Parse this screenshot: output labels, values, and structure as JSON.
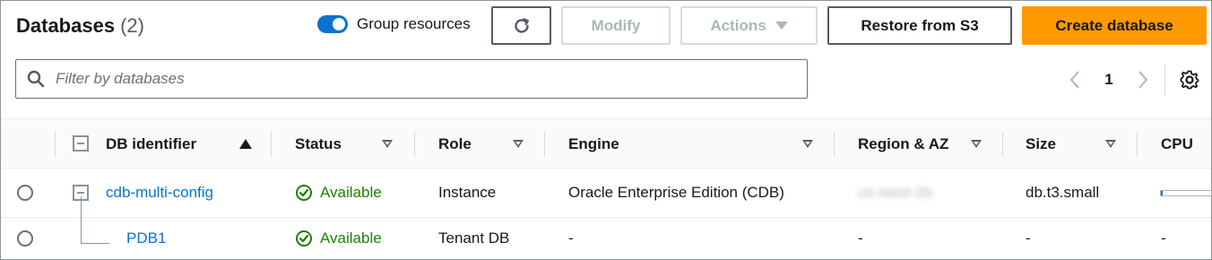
{
  "header": {
    "title": "Databases",
    "count": "(2)"
  },
  "group_resources": {
    "label": "Group resources",
    "enabled": true
  },
  "toolbar": {
    "refresh_icon": "refresh-icon",
    "modify_label": "Modify",
    "actions_label": "Actions",
    "restore_label": "Restore from S3",
    "create_label": "Create database"
  },
  "search": {
    "placeholder": "Filter by databases",
    "value": ""
  },
  "pagination": {
    "current_page": "1"
  },
  "table": {
    "columns": [
      {
        "label": "DB identifier",
        "sort": "ascending"
      },
      {
        "label": "Status",
        "sort": "none"
      },
      {
        "label": "Role",
        "sort": "none"
      },
      {
        "label": "Engine",
        "sort": "none"
      },
      {
        "label": "Region & AZ",
        "sort": "none"
      },
      {
        "label": "Size",
        "sort": "none"
      },
      {
        "label": "CPU",
        "sort": "none"
      }
    ],
    "rows": [
      {
        "identifier": "cdb-multi-config",
        "status": "Available",
        "role": "Instance",
        "engine": "Oracle Enterprise Edition (CDB)",
        "region": "us-west-2b",
        "size": "db.t3.small",
        "cpu_fraction": 0.03
      },
      {
        "identifier": "PDB1",
        "status": "Available",
        "role": "Tenant DB",
        "engine": "-",
        "region": "-",
        "size": "-",
        "cpu": "-"
      }
    ]
  },
  "colors": {
    "primary": "#ff9900",
    "link": "#0972d3",
    "success": "#1d8102"
  }
}
